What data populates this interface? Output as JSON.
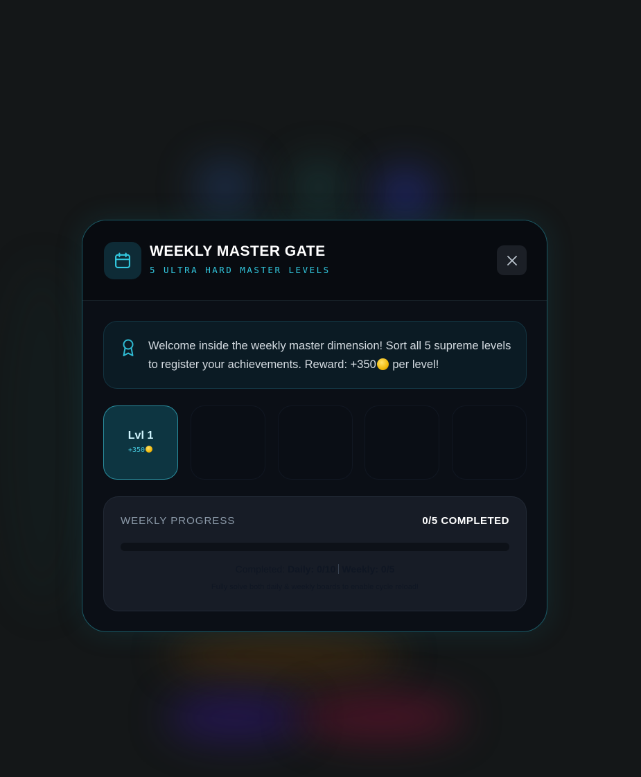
{
  "modal": {
    "title": "WEEKLY MASTER GATE",
    "subtitle": "5 ULTRA HARD MASTER LEVELS",
    "header_icon": "calendar-icon",
    "close_icon": "close-icon"
  },
  "welcome": {
    "icon": "award-ribbon-icon",
    "text_before_coin": "Welcome inside the weekly master dimension! Sort all 5 supreme levels to register your achievements. Reward: +350",
    "text_after_coin": " per level!"
  },
  "levels": [
    {
      "label": "Lvl 1",
      "reward": "+350",
      "active": true
    },
    {
      "label": "",
      "reward": "",
      "active": false
    },
    {
      "label": "",
      "reward": "",
      "active": false
    },
    {
      "label": "",
      "reward": "",
      "active": false
    },
    {
      "label": "",
      "reward": "",
      "active": false
    }
  ],
  "progress": {
    "label": "WEEKLY PROGRESS",
    "count": "0/5 COMPLETED",
    "fraction": 0,
    "completed_prefix": "Completed: ",
    "daily": "Daily: 0/10",
    "weekly": "Weekly: 0/5",
    "hint": "Fully solve both daily & weekly boards to enable cycle reload!"
  },
  "colors": {
    "accent": "#32c8df",
    "modal_border": "#1b5a66",
    "coin": "#f0b90b"
  }
}
